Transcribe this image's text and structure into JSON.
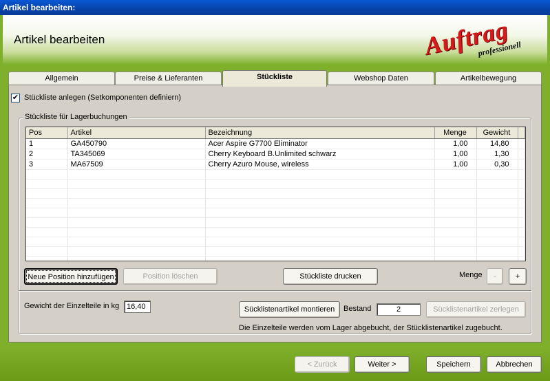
{
  "window": {
    "title": "Artikel bearbeiten:"
  },
  "header": {
    "title": "Artikel bearbeiten",
    "logo_main": "Auftrag",
    "logo_sub": "professionell"
  },
  "tabs": [
    {
      "label": "Allgemein"
    },
    {
      "label": "Preise & Lieferanten"
    },
    {
      "label": "Stückliste"
    },
    {
      "label": "Webshop Daten"
    },
    {
      "label": "Artikelbewegung"
    }
  ],
  "checkbox": {
    "label": "Stückliste anlegen (Setkomponenten definiern)",
    "checked": true,
    "mark": "✔"
  },
  "group": {
    "label": "Stückliste für Lagerbuchungen"
  },
  "table": {
    "columns": [
      "Pos",
      "Artikel",
      "Bezeichnung",
      "Menge",
      "Gewicht"
    ],
    "rows": [
      {
        "pos": "1",
        "artikel": "GA450790",
        "bezeichnung": "Acer Aspire G7700 Eliminator",
        "menge": "1,00",
        "gewicht": "14,80"
      },
      {
        "pos": "2",
        "artikel": "TA345069",
        "bezeichnung": "Cherry Keyboard B.Unlimited schwarz",
        "menge": "1,00",
        "gewicht": "1,30"
      },
      {
        "pos": "3",
        "artikel": "MA67509",
        "bezeichnung": "Cherry Azuro Mouse, wireless",
        "menge": "1,00",
        "gewicht": "0,30"
      }
    ]
  },
  "buttons": {
    "add_position": "Neue Position hinzufügen",
    "delete_position": "Position löschen",
    "print_list": "Stückliste drucken",
    "menge_label": "Menge",
    "minus": "-",
    "plus": "+",
    "montieren": "Sücklistenartikel montieren",
    "zerlegen": "Sücklistenartikel zerlegen"
  },
  "weight": {
    "label": "Gewicht der Einzelteile in kg",
    "value": "16,40"
  },
  "bestand": {
    "label": "Bestand",
    "value": "2"
  },
  "info_text": "Die Einzelteile werden vom Lager abgebucht, der Stücklistenartikel zugebucht.",
  "nav": {
    "back": "< Zurück",
    "next": "Weiter >",
    "save": "Speichern",
    "cancel": "Abbrechen"
  }
}
